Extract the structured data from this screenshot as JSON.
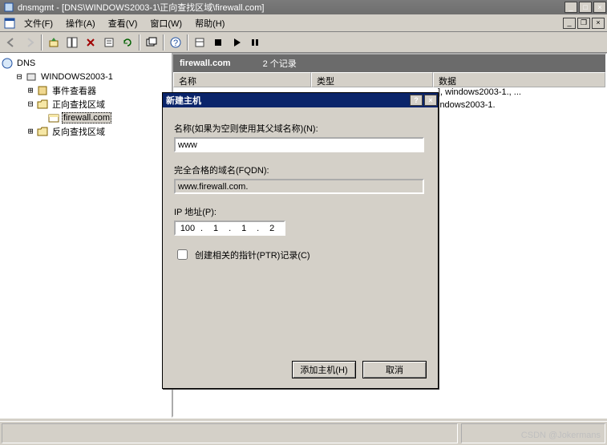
{
  "title": "dnsmgmt - [DNS\\WINDOWS2003-1\\正向查找区域\\firewall.com]",
  "menu": {
    "file": "文件(F)",
    "action": "操作(A)",
    "view": "查看(V)",
    "window": "窗口(W)",
    "help": "帮助(H)"
  },
  "tree": {
    "root": "DNS",
    "server": "WINDOWS2003-1",
    "eventviewer": "事件查看器",
    "fwdzone": "正向查找区域",
    "zone": "firewall.com",
    "revzone": "反向查找区域"
  },
  "zoneheader": {
    "name": "firewall.com",
    "count": "2 个记录"
  },
  "columns": {
    "name": "名称",
    "type": "类型",
    "data": "数据"
  },
  "records": [
    {
      "data_suffix": "], windows2003-1., ..."
    },
    {
      "data_suffix": "indows2003-1."
    }
  ],
  "dialog": {
    "title": "新建主机",
    "name_label": "名称(如果为空则使用其父域名称)(N):",
    "name_value": "www",
    "fqdn_label": "完全合格的域名(FQDN):",
    "fqdn_value": "www.firewall.com.",
    "ip_label": "IP 地址(P):",
    "ip": [
      "100",
      "1",
      "1",
      "2"
    ],
    "ptr_label": "创建相关的指针(PTR)记录(C)",
    "add": "添加主机(H)",
    "cancel": "取消"
  },
  "watermark": "CSDN @Jokermans",
  "watermark2": ""
}
